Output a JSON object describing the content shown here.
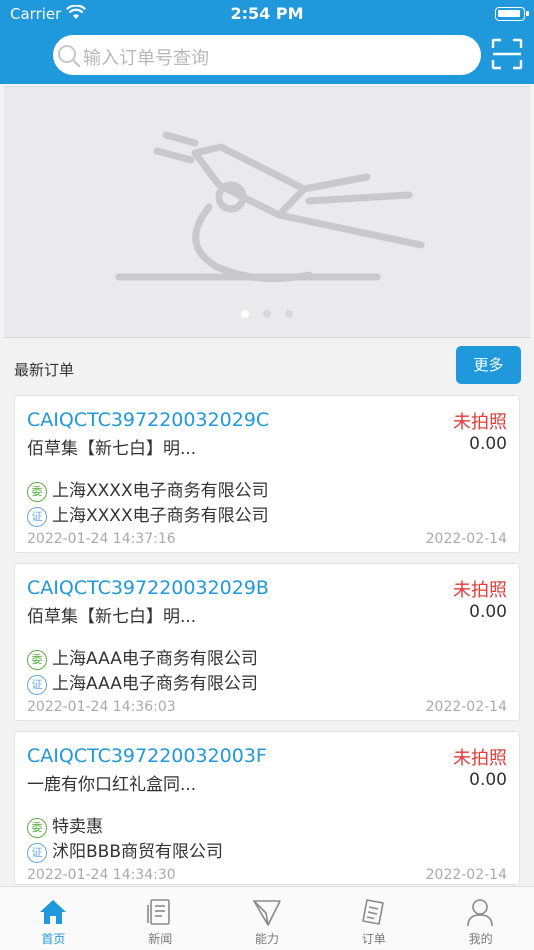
{
  "status_bar": {
    "carrier": "Carrier",
    "time": "2:54 PM"
  },
  "search": {
    "placeholder": "输入订单号查询"
  },
  "section": {
    "title": "最新订单",
    "more_label": "更多"
  },
  "orders": [
    {
      "order_no": "CAIQCTC397220032029C",
      "status": "未拍照",
      "product": "佰草集【新七白】明...",
      "amount": "0.00",
      "client_badge": "委",
      "client": "上海XXXX电子商务有限公司",
      "cert_badge": "证",
      "cert_holder": "上海XXXX电子商务有限公司",
      "created": "2022-01-24 14:37:16",
      "due": "2022-02-14"
    },
    {
      "order_no": "CAIQCTC397220032029B",
      "status": "未拍照",
      "product": "佰草集【新七白】明...",
      "amount": "0.00",
      "client_badge": "委",
      "client": "上海AAA电子商务有限公司",
      "cert_badge": "证",
      "cert_holder": "上海AAA电子商务有限公司",
      "created": "2022-01-24 14:36:03",
      "due": "2022-02-14"
    },
    {
      "order_no": "CAIQCTC397220032003F",
      "status": "未拍照",
      "product": "一鹿有你口红礼盒同...",
      "amount": "0.00",
      "client_badge": "委",
      "client": "特卖惠",
      "cert_badge": "证",
      "cert_holder": "沭阳BBB商贸有限公司",
      "created": "2022-01-24 14:34:30",
      "due": "2022-02-14"
    }
  ],
  "tabs": [
    {
      "label": "首页",
      "icon": "home-icon",
      "active": true
    },
    {
      "label": "新闻",
      "icon": "news-icon",
      "active": false
    },
    {
      "label": "能力",
      "icon": "send-icon",
      "active": false
    },
    {
      "label": "订单",
      "icon": "order-icon",
      "active": false
    },
    {
      "label": "我的",
      "icon": "user-icon",
      "active": false
    }
  ],
  "colors": {
    "brand": "#1f98dc",
    "status_alert": "#e33b36",
    "client_badge": "#5ab045",
    "cert_badge": "#6ba6d8"
  }
}
